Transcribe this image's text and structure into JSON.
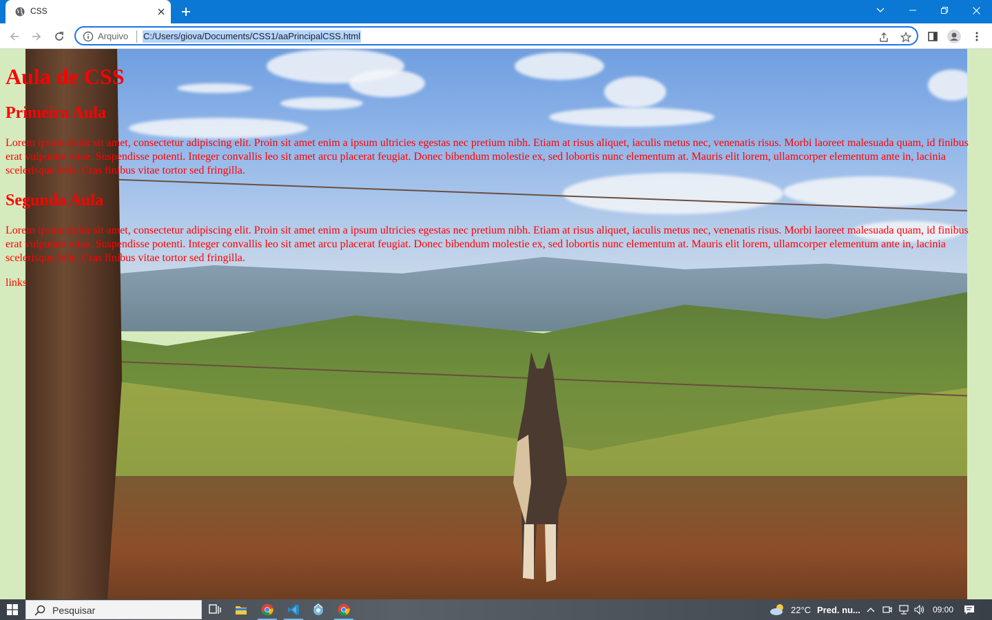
{
  "browser": {
    "tab": {
      "title": "CSS",
      "close_icon": "close-icon",
      "favicon": "globe-icon"
    },
    "new_tab_icon": "plus-icon",
    "window_controls": [
      "chevron-down-icon",
      "minimize-icon",
      "restore-icon",
      "close-icon"
    ],
    "address": {
      "security_label": "Arquivo",
      "url": "C:/Users/giova/Documents/CSS1/aaPrincipalCSS.html"
    },
    "accent": "#0a78d4"
  },
  "page": {
    "background_color": "#d5ebbd",
    "text_color": "#ff0000",
    "heading1": "Aula de CSS",
    "section1_title": "Primeira Aula",
    "section1_text": "Lorem ipsum dolor sit amet, consectetur adipiscing elit. Proin sit amet enim a ipsum ultricies egestas nec pretium nibh. Etiam at risus aliquet, iaculis metus nec, venenatis risus. Morbi laoreet malesuada quam, id finibus erat vulputate vitae. Suspendisse potenti. Integer convallis leo sit amet arcu placerat feugiat. Donec bibendum molestie ex, sed lobortis nunc elementum at. Mauris elit lorem, ullamcorper elementum ante in, lacinia scelerisque felis. Cras finibus vitae tortor sed fringilla.",
    "section2_title": "Segunda Aula",
    "section2_text": "Lorem ipsum dolor sit amet, consectetur adipiscing elit. Proin sit amet enim a ipsum ultricies egestas nec pretium nibh. Etiam at risus aliquet, iaculis metus nec, venenatis risus. Morbi laoreet malesuada quam, id finibus erat vulputate vitae. Suspendisse potenti. Integer convallis leo sit amet arcu placerat feugiat. Donec bibendum molestie ex, sed lobortis nunc elementum at. Mauris elit lorem, ullamcorper elementum ante in, lacinia scelerisque felis. Cras finibus vitae tortor sed fringilla.",
    "links_text": "links"
  },
  "taskbar": {
    "search_placeholder": "Pesquisar",
    "apps": [
      "task-view-icon",
      "file-explorer-icon",
      "chrome-icon",
      "vscode-icon",
      "app-icon",
      "chrome-icon"
    ],
    "weather_temp": "22°C",
    "weather_text": "Pred. nu...",
    "clock": "09:00"
  }
}
